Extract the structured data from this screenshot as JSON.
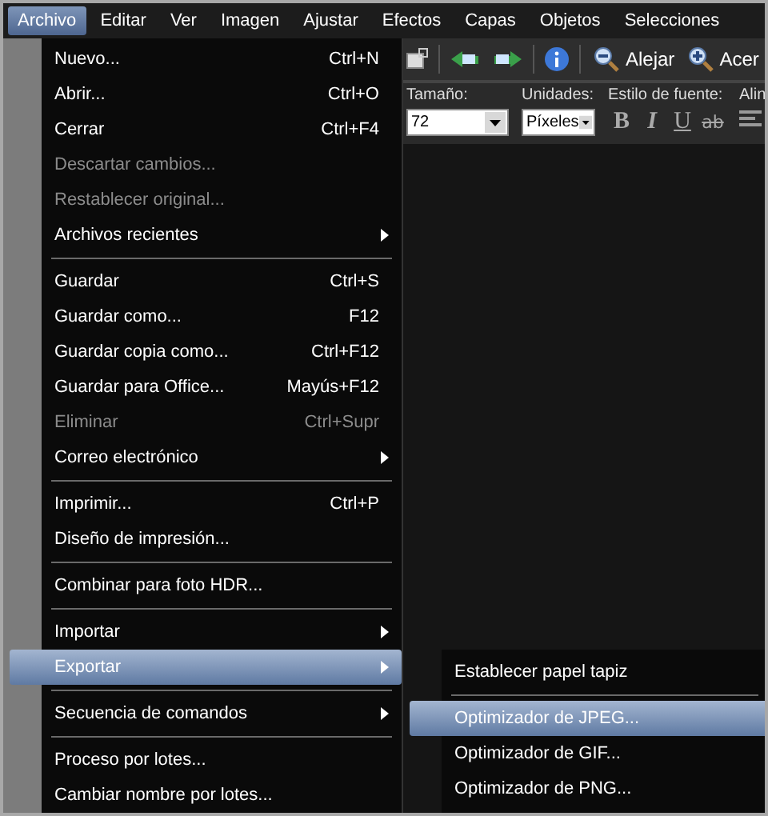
{
  "menu_bar": [
    {
      "label": "Archivo",
      "selected": true
    },
    {
      "label": "Editar",
      "selected": false
    },
    {
      "label": "Ver",
      "selected": false
    },
    {
      "label": "Imagen",
      "selected": false
    },
    {
      "label": "Ajustar",
      "selected": false
    },
    {
      "label": "Efectos",
      "selected": false
    },
    {
      "label": "Capas",
      "selected": false
    },
    {
      "label": "Objetos",
      "selected": false
    },
    {
      "label": "Selecciones",
      "selected": false
    }
  ],
  "toolbar": {
    "zoom_out": "Alejar",
    "zoom_in": "Acer"
  },
  "text_toolbar": {
    "size_label": "Tamaño:",
    "size_value": "72",
    "units_label": "Unidades:",
    "units_value": "Píxeles",
    "font_style_label": "Estilo de fuente:",
    "align_label": "Alin",
    "bold": "B",
    "italic": "I",
    "underline": "U",
    "strikethrough": "ab"
  },
  "file_menu": [
    {
      "kind": "item",
      "label": "Nuevo...",
      "shortcut": "Ctrl+N",
      "disabled": false,
      "submenu": false,
      "selected": false
    },
    {
      "kind": "item",
      "label": "Abrir...",
      "shortcut": "Ctrl+O",
      "disabled": false,
      "submenu": false,
      "selected": false
    },
    {
      "kind": "item",
      "label": "Cerrar",
      "shortcut": "Ctrl+F4",
      "disabled": false,
      "submenu": false,
      "selected": false
    },
    {
      "kind": "item",
      "label": "Descartar cambios...",
      "disabled": true,
      "submenu": false,
      "selected": false
    },
    {
      "kind": "item",
      "label": "Restablecer original...",
      "disabled": true,
      "submenu": false,
      "selected": false
    },
    {
      "kind": "item",
      "label": "Archivos recientes",
      "disabled": false,
      "submenu": true,
      "selected": false
    },
    {
      "kind": "separator"
    },
    {
      "kind": "item",
      "label": "Guardar",
      "shortcut": "Ctrl+S",
      "disabled": false,
      "submenu": false,
      "selected": false
    },
    {
      "kind": "item",
      "label": "Guardar como...",
      "shortcut": "F12",
      "disabled": false,
      "submenu": false,
      "selected": false
    },
    {
      "kind": "item",
      "label": "Guardar copia como...",
      "shortcut": "Ctrl+F12",
      "disabled": false,
      "submenu": false,
      "selected": false
    },
    {
      "kind": "item",
      "label": "Guardar para Office...",
      "shortcut": "Mayús+F12",
      "disabled": false,
      "submenu": false,
      "selected": false
    },
    {
      "kind": "item",
      "label": "Eliminar",
      "shortcut": "Ctrl+Supr",
      "disabled": true,
      "submenu": false,
      "selected": false
    },
    {
      "kind": "item",
      "label": "Correo electrónico",
      "disabled": false,
      "submenu": true,
      "selected": false
    },
    {
      "kind": "separator"
    },
    {
      "kind": "item",
      "label": "Imprimir...",
      "shortcut": "Ctrl+P",
      "disabled": false,
      "submenu": false,
      "selected": false
    },
    {
      "kind": "item",
      "label": "Diseño de impresión...",
      "disabled": false,
      "submenu": false,
      "selected": false
    },
    {
      "kind": "separator"
    },
    {
      "kind": "item",
      "label": "Combinar para foto HDR...",
      "disabled": false,
      "submenu": false,
      "selected": false
    },
    {
      "kind": "separator"
    },
    {
      "kind": "item",
      "label": "Importar",
      "disabled": false,
      "submenu": true,
      "selected": false
    },
    {
      "kind": "item",
      "label": "Exportar",
      "disabled": false,
      "submenu": true,
      "selected": true
    },
    {
      "kind": "separator"
    },
    {
      "kind": "item",
      "label": "Secuencia de comandos",
      "disabled": false,
      "submenu": true,
      "selected": false
    },
    {
      "kind": "separator"
    },
    {
      "kind": "item",
      "label": "Proceso por lotes...",
      "disabled": false,
      "submenu": false,
      "selected": false
    },
    {
      "kind": "item",
      "label": "Cambiar nombre por lotes...",
      "disabled": false,
      "submenu": false,
      "selected": false
    }
  ],
  "export_submenu": [
    {
      "kind": "item",
      "label": "Establecer papel tapiz",
      "disabled": false,
      "submenu": false,
      "selected": false
    },
    {
      "kind": "separator"
    },
    {
      "kind": "item",
      "label": "Optimizador de JPEG...",
      "disabled": false,
      "submenu": false,
      "selected": true
    },
    {
      "kind": "item",
      "label": "Optimizador de GIF...",
      "disabled": false,
      "submenu": false,
      "selected": false
    },
    {
      "kind": "item",
      "label": "Optimizador de PNG...",
      "disabled": false,
      "submenu": false,
      "selected": false
    }
  ]
}
